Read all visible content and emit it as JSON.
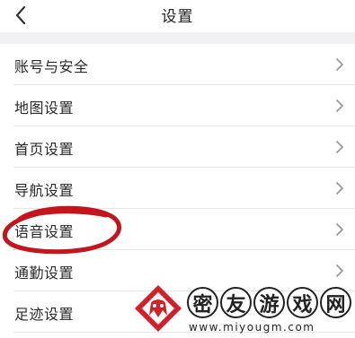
{
  "header": {
    "title": "设置",
    "back_icon": "chevron-left-icon"
  },
  "settings": {
    "items": [
      {
        "label": "账号与安全",
        "icon": "chevron-right-icon"
      },
      {
        "label": "地图设置",
        "icon": "chevron-right-icon"
      },
      {
        "label": "首页设置",
        "icon": "chevron-right-icon"
      },
      {
        "label": "导航设置",
        "icon": "chevron-right-icon"
      },
      {
        "label": "语音设置",
        "icon": "chevron-right-icon",
        "highlighted": true
      },
      {
        "label": "通勤设置",
        "icon": "chevron-right-icon"
      },
      {
        "label": "足迹设置",
        "icon": "chevron-right-icon"
      }
    ]
  },
  "annotation": {
    "color": "#c4141c",
    "target": "语音设置"
  },
  "watermark": {
    "chars": [
      "密",
      "友",
      "游",
      "戏",
      "网"
    ],
    "url": "www.miyougm.com",
    "logo_color": "#d0202a"
  }
}
